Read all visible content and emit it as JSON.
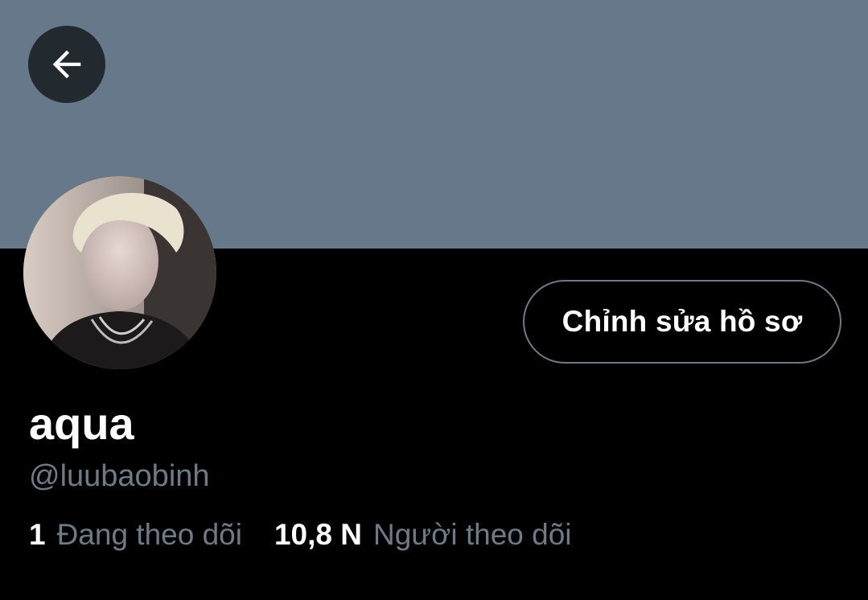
{
  "profile": {
    "display_name": "aqua",
    "handle": "@luubaobinh",
    "edit_button_label": "Chỉnh sửa hồ sơ",
    "following_count": "1",
    "following_label": "Đang theo dõi",
    "followers_count": "10,8 N",
    "followers_label": "Người theo dõi"
  },
  "colors": {
    "banner": "#66788a",
    "background": "#000000",
    "secondary_text": "#6e7b87",
    "button_border": "#6f7a84"
  },
  "icons": {
    "back": "arrow-left-icon"
  }
}
